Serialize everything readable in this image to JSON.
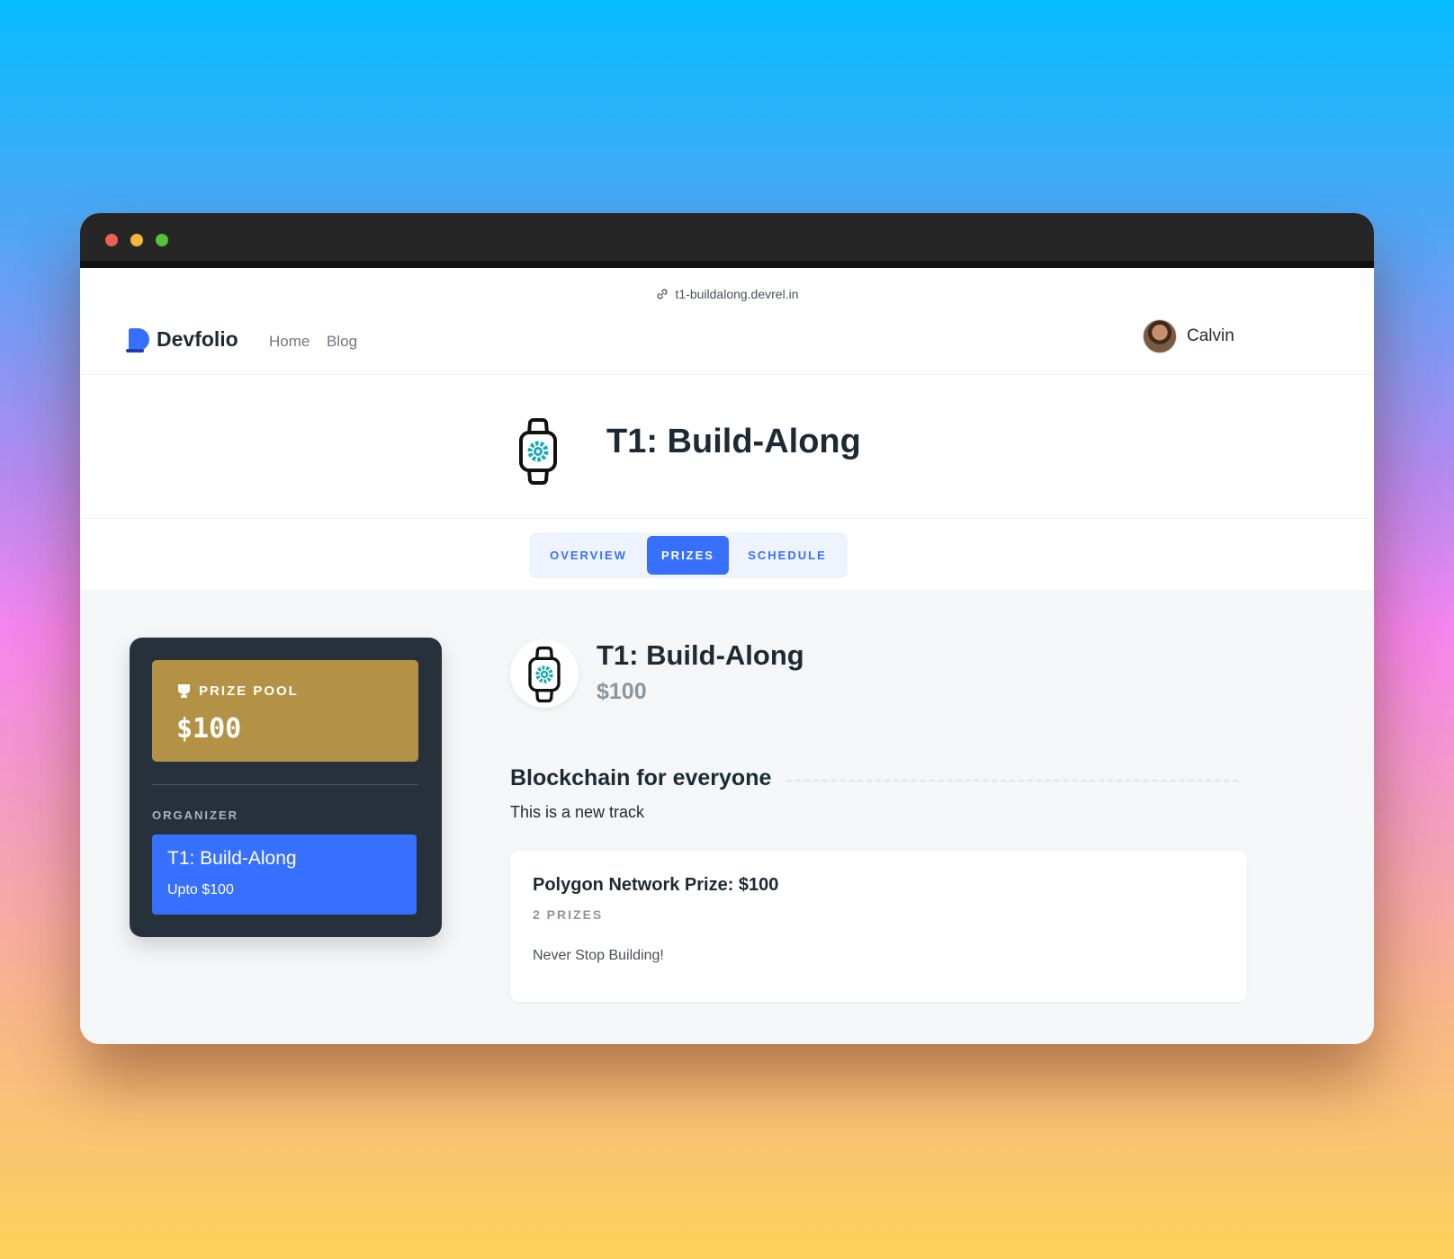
{
  "url": "t1-buildalong.devrel.in",
  "nav": {
    "brand": "Devfolio",
    "links": [
      "Home",
      "Blog"
    ],
    "user_name": "Calvin"
  },
  "hero": {
    "title": "T1: Build-Along"
  },
  "tabs": [
    {
      "label": "OVERVIEW",
      "active": false
    },
    {
      "label": "PRIZES",
      "active": true
    },
    {
      "label": "SCHEDULE",
      "active": false
    }
  ],
  "prize_card": {
    "pool_label": "PRIZE POOL",
    "pool_amount": "$100",
    "organizer_label": "ORGANIZER",
    "organizer_name": "T1: Build-Along",
    "organizer_sub": "Upto $100"
  },
  "track": {
    "title": "T1: Build-Along",
    "amount": "$100",
    "section_title": "Blockchain for everyone",
    "section_subtitle": "This is a new track"
  },
  "prize": {
    "title": "Polygon Network Prize: $100",
    "count": "2 PRIZES",
    "description": "Never Stop Building!"
  },
  "colors": {
    "accent": "#3770ff",
    "pool_gold": "#b49245",
    "card_dark": "#27313b",
    "icon_teal": "#18a7b5"
  },
  "icons": {
    "url": "link-icon",
    "track": "smartwatch-gear-icon",
    "pool": "trophy-icon"
  }
}
